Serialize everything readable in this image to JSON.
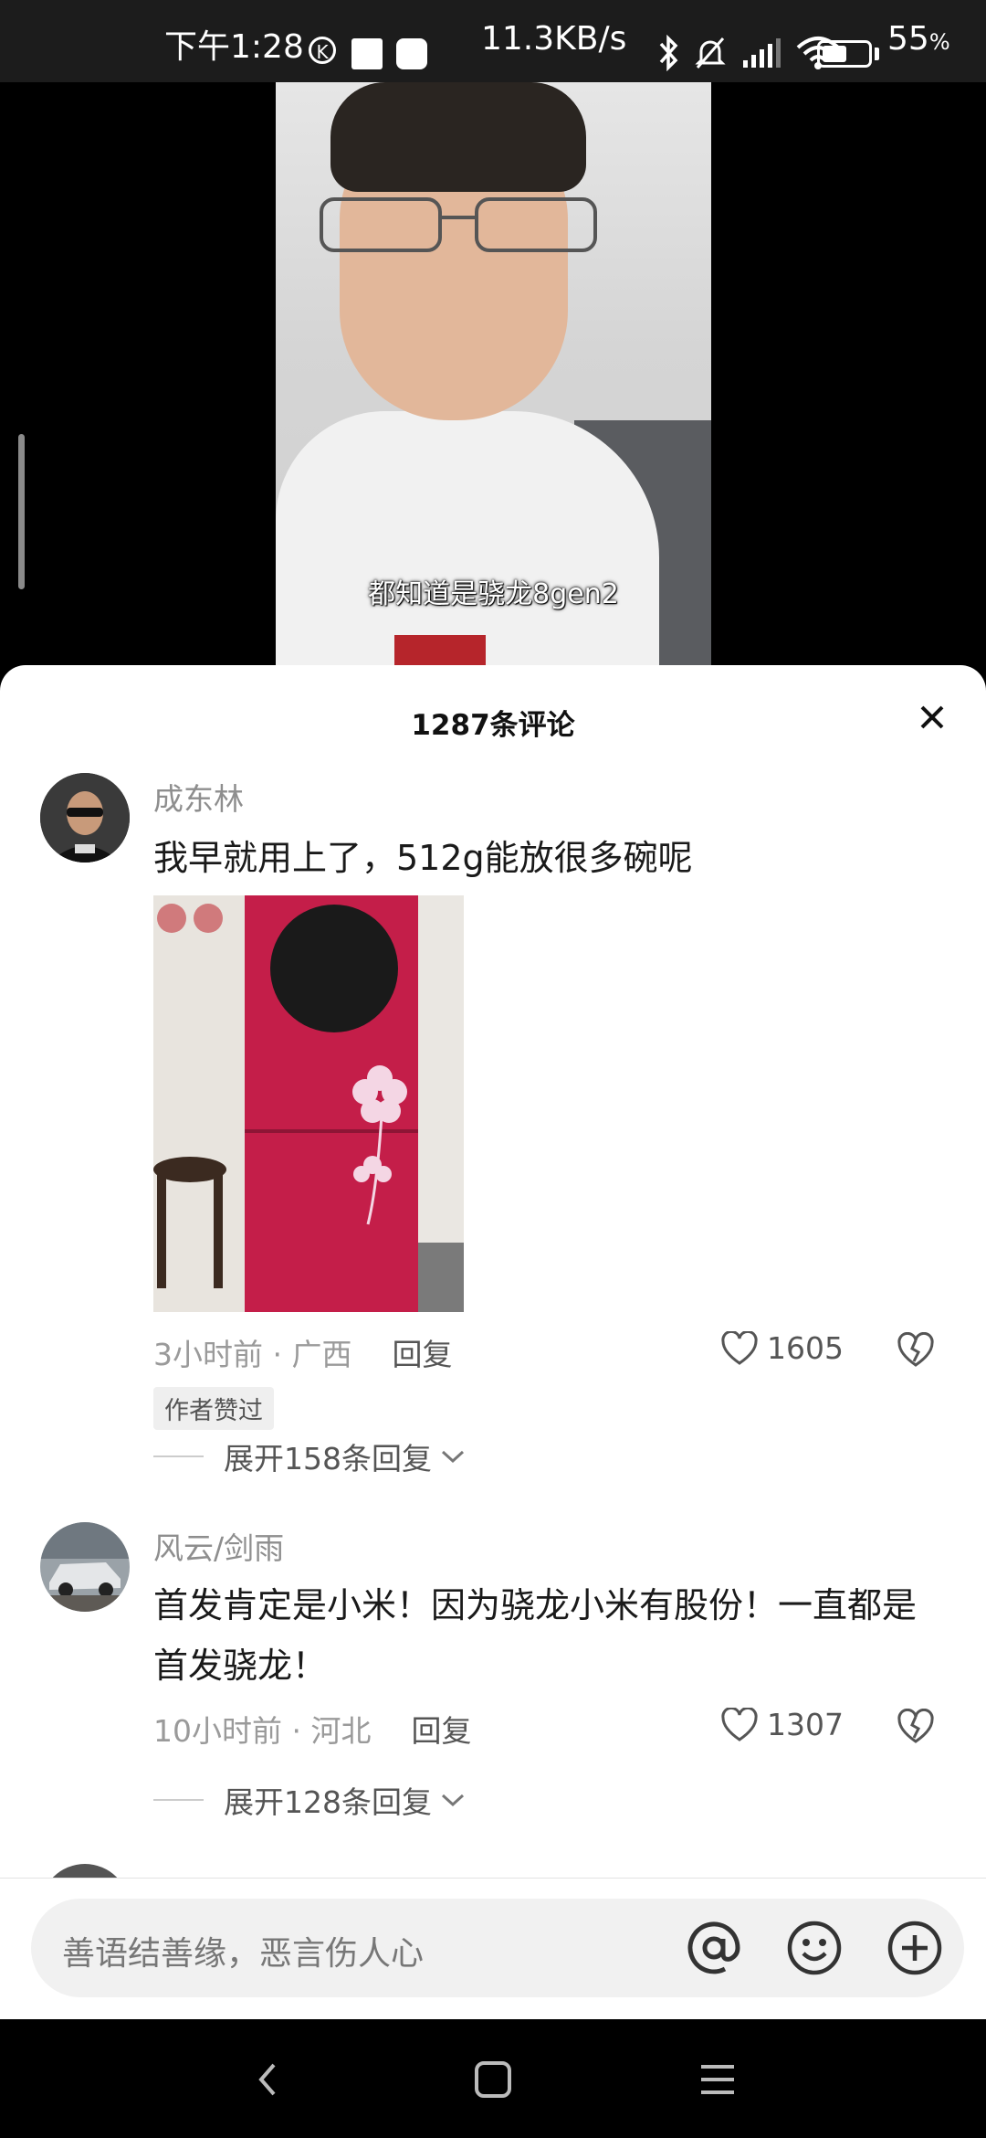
{
  "status_bar": {
    "time": "下午1:28",
    "k_badge": "K",
    "net_speed": "11.3KB/s",
    "battery_percent": "55",
    "battery_suffix": "%",
    "battery_level": 0.55
  },
  "video": {
    "caption": "都知道是骁龙8gen2"
  },
  "comments_panel": {
    "title": "1287条评论",
    "comments": [
      {
        "user": "成东林",
        "text": "我早就用上了，512g能放很多碗呢",
        "time_location": "3小时前 · 广西",
        "reply_label": "回复",
        "likes": "1605",
        "badge": "作者赞过",
        "expand_label": "展开158条回复"
      },
      {
        "user": "风云/剑雨",
        "text": "首发肯定是小米！因为骁龙小米有股份！一直都是首发骁龙！",
        "time_location": "10小时前 · 河北",
        "reply_label": "回复",
        "likes": "1307",
        "expand_label": "展开128条回复"
      }
    ]
  },
  "input_bar": {
    "placeholder": "善语结善缘，恶言伤人心"
  },
  "colors": {
    "panel_bg": "#ffffff",
    "name_gray": "#8e8e8e",
    "status_bg": "#1c1c1c"
  }
}
